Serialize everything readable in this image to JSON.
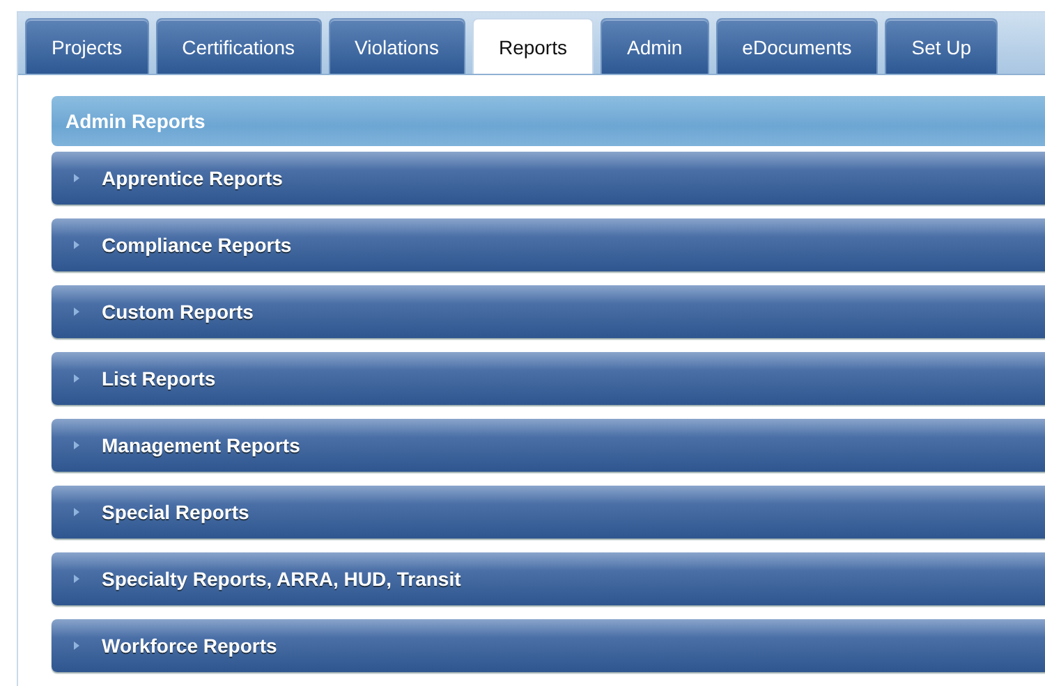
{
  "tabs": [
    {
      "label": "Projects",
      "selected": false
    },
    {
      "label": "Certifications",
      "selected": false
    },
    {
      "label": "Violations",
      "selected": false
    },
    {
      "label": "Reports",
      "selected": true
    },
    {
      "label": "Admin",
      "selected": false
    },
    {
      "label": "eDocuments",
      "selected": false
    },
    {
      "label": "Set Up",
      "selected": false
    }
  ],
  "panel": {
    "title": "Admin Reports"
  },
  "sections": [
    {
      "label": "Apprentice Reports",
      "expanded": false
    },
    {
      "label": "Compliance Reports",
      "expanded": false
    },
    {
      "label": "Custom Reports",
      "expanded": false
    },
    {
      "label": "List Reports",
      "expanded": false
    },
    {
      "label": "Management Reports",
      "expanded": false
    },
    {
      "label": "Special Reports",
      "expanded": false
    },
    {
      "label": "Specialty Reports, ARRA, HUD, Transit",
      "expanded": false
    },
    {
      "label": "Workforce Reports",
      "expanded": false
    }
  ]
}
